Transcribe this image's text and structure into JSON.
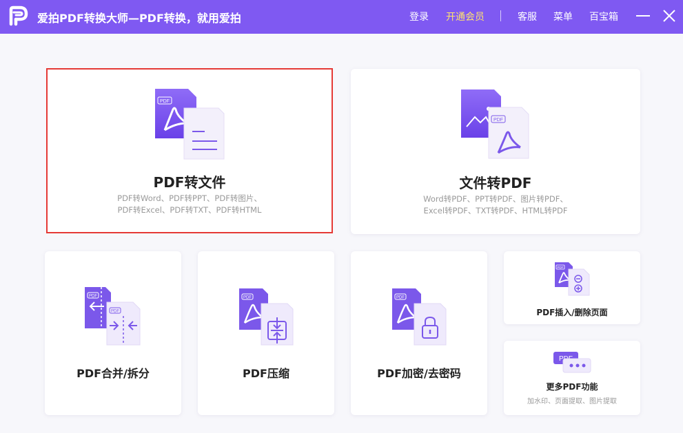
{
  "app": {
    "title": "爱拍PDF转换大师—PDF转换，就用爱拍",
    "accent": "#7f59f2",
    "vip_color": "#ffe36e"
  },
  "toolbar": {
    "login": "登录",
    "vip": "开通会员",
    "service": "客服",
    "menu": "菜单",
    "toolbox": "百宝箱",
    "minimize_icon": "minimize-icon",
    "close_icon": "close-icon"
  },
  "cards": {
    "pdf_to_file": {
      "title": "PDF转文件",
      "desc1": "PDF转Word、PDF转PPT、PDF转图片、",
      "desc2": "PDF转Excel、PDF转TXT、PDF转HTML",
      "badge": "PDF"
    },
    "file_to_pdf": {
      "title": "文件转PDF",
      "desc1": "Word转PDF、PPT转PDF、图片转PDF、",
      "desc2": "Excel转PDF、TXT转PDF、HTML转PDF",
      "badge": "PDF"
    },
    "merge_split": {
      "title": "PDF合并/拆分",
      "badge": "PDF"
    },
    "compress": {
      "title": "PDF压缩",
      "badge": "PDF"
    },
    "encrypt": {
      "title": "PDF加密/去密码",
      "badge": "PDF"
    },
    "insert_delete": {
      "title": "PDF插入/删除页面",
      "badge": "PDF"
    },
    "more": {
      "title": "更多PDF功能",
      "desc": "加水印、页面提取、图片提取",
      "badge": "PDF"
    }
  }
}
